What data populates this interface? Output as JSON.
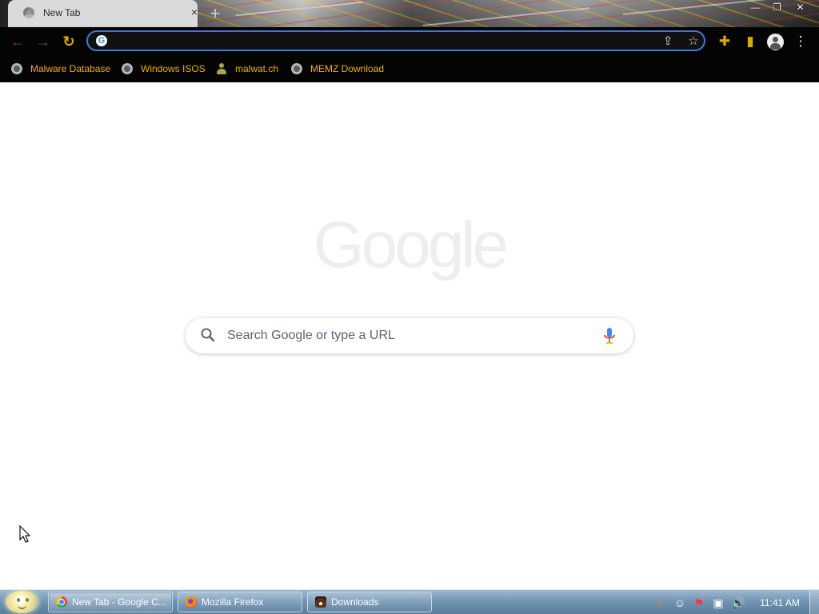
{
  "browser": {
    "tab": {
      "title": "New Tab",
      "close_label": "×"
    },
    "new_tab_label": "+",
    "window_controls": {
      "minimize": "—",
      "restore": "❐",
      "close": "✕"
    },
    "toolbar": {
      "back": "←",
      "forward": "→",
      "reload": "↻",
      "address_value": "",
      "google_mark": "G",
      "share": "⇪",
      "bookmark": "☆",
      "extensions": "✚",
      "side_panel": "▮",
      "menu": "⋮"
    },
    "bookmarks": [
      {
        "label": "Malware Database",
        "icon": "globe-icon"
      },
      {
        "label": "Windows ISOS",
        "icon": "globe-icon"
      },
      {
        "label": "malwat.ch",
        "icon": "people-icon"
      },
      {
        "label": "MEMZ Download",
        "icon": "globe-icon"
      }
    ]
  },
  "new_tab_page": {
    "logo_text": "Google",
    "search_placeholder": "Search Google or type a URL"
  },
  "taskbar": {
    "windows": [
      {
        "label": "New Tab - Google C...",
        "icon": "chrome-icon",
        "active": true
      },
      {
        "label": "Mozilla Firefox",
        "icon": "firefox-icon",
        "active": false
      },
      {
        "label": "Downloads",
        "icon": "downloads-icon",
        "active": false
      }
    ],
    "tray": {
      "search_icon": "⌕",
      "status_icon": "☺",
      "flag_icon": "⚑",
      "network_icon": "▣",
      "volume_icon": "🔊",
      "time": "11:41 AM"
    }
  },
  "colors": {
    "toolbar_background": "#040404",
    "bookmark_text": "#f0b000",
    "omnibox_border": "#3f79d6",
    "taskbar_blue": "#6f91b0"
  }
}
